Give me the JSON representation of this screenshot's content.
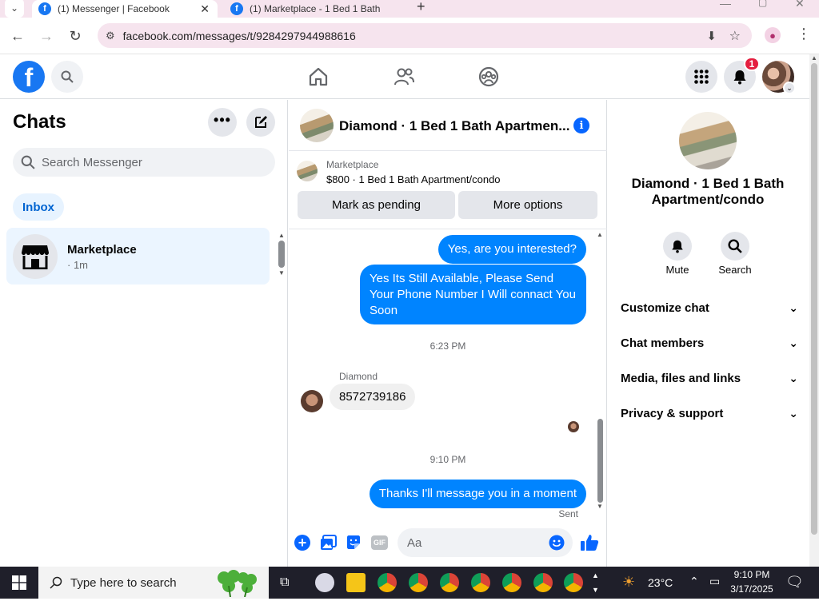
{
  "browser": {
    "tabs": [
      {
        "label": "(1) Messenger | Facebook",
        "active": true
      },
      {
        "label": "(1) Marketplace - 1 Bed 1 Bath",
        "active": false
      }
    ],
    "url": "facebook.com/messages/t/9284297944988616"
  },
  "header": {
    "notification_count": "1"
  },
  "chats": {
    "title": "Chats",
    "search_placeholder": "Search Messenger",
    "filter_label": "Inbox",
    "items": [
      {
        "name": "Marketplace",
        "meta": "· 1m"
      }
    ]
  },
  "conversation": {
    "title": "Diamond · 1 Bed 1 Bath Apartmen...",
    "listing_source": "Marketplace",
    "listing_title": "$800 · 1 Bed 1 Bath Apartment/condo",
    "mark_pending_label": "Mark as pending",
    "more_options_label": "More options",
    "messages": [
      {
        "text": "Yes, are you interested?"
      },
      {
        "text": "Yes Its Still Available, Please Send Your Phone Number I Will connact You Soon"
      }
    ],
    "time1": "6:23 PM",
    "sender_name": "Diamond",
    "incoming_text": "8572739186",
    "time2": "9:10 PM",
    "last_message": "Thanks I'll message you in a moment",
    "sent_status": "Sent",
    "composer_placeholder": "Aa",
    "gif_label": "GIF"
  },
  "info": {
    "name": "Diamond · 1 Bed 1 Bath Apartment/condo",
    "mute_label": "Mute",
    "search_label": "Search",
    "sections": [
      "Customize chat",
      "Chat members",
      "Media, files and links",
      "Privacy & support"
    ]
  },
  "taskbar": {
    "search_placeholder": "Type here to search",
    "weather": "23°C",
    "time": "9:10 PM",
    "date": "3/17/2025"
  },
  "colors": {
    "brand": "#1877f2",
    "bubble": "#0084ff",
    "taskbar": "#1f1f2a"
  }
}
